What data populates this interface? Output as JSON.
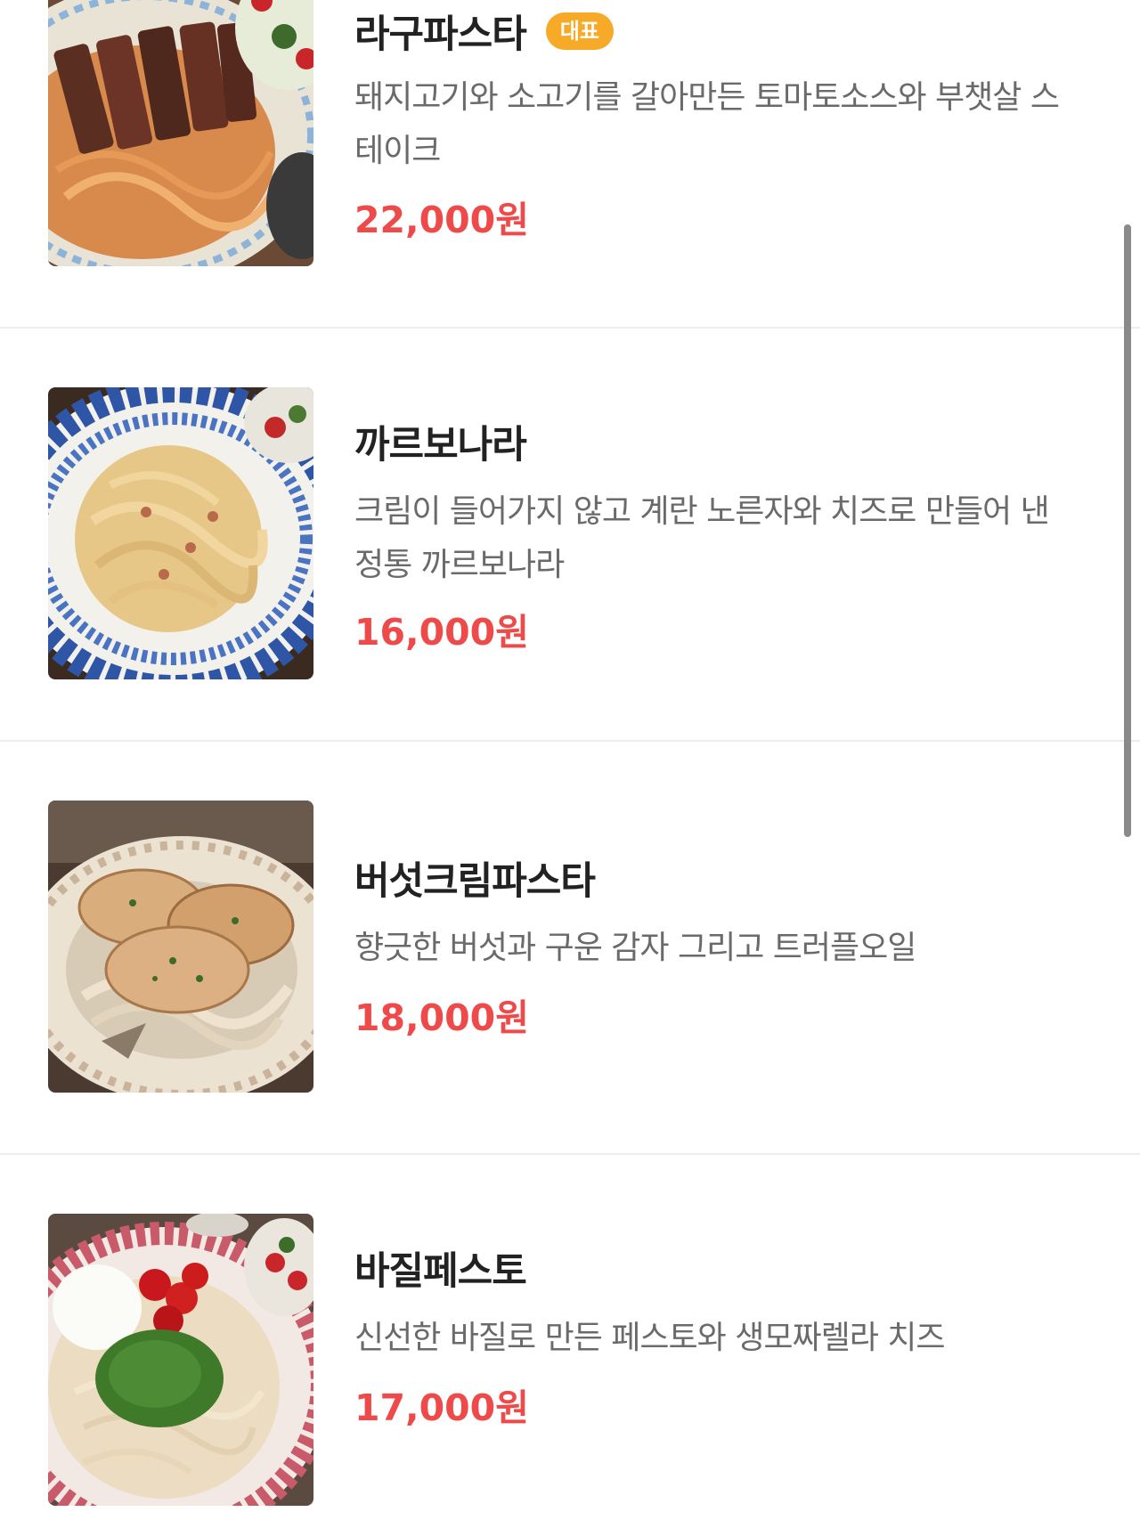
{
  "menu": {
    "items": [
      {
        "name": "라구파스타",
        "badge": "대표",
        "description": "돼지고기와 소고기를 갈아만든 토마토소스와 부챗살 스테이크",
        "price": "22,000원",
        "image": "ragu-pasta-steak-photo"
      },
      {
        "name": "까르보나라",
        "description": "크림이 들어가지 않고 계란 노른자와 치즈로 만들어 낸 정통 까르보나라",
        "price": "16,000원",
        "image": "carbonara-photo"
      },
      {
        "name": "버섯크림파스타",
        "description": "향긋한 버섯과 구운 감자 그리고 트러플오일",
        "price": "18,000원",
        "image": "mushroom-cream-pasta-photo"
      },
      {
        "name": "바질페스토",
        "description": "신선한 바질로 만든 페스토와 생모짜렐라 치즈",
        "price": "17,000원",
        "image": "basil-pesto-photo"
      }
    ]
  },
  "colors": {
    "price": "#ef4a4a",
    "badge": "#f7a928",
    "divider": "#ececec"
  }
}
